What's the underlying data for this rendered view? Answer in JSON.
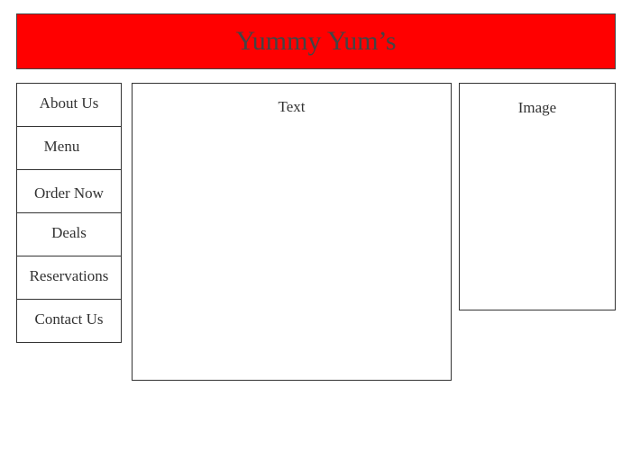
{
  "header": {
    "title": "Yummy Yum’s",
    "background_color": "#ff0000"
  },
  "nav": {
    "items": [
      {
        "label": "About Us"
      },
      {
        "label": "Menu"
      },
      {
        "label": "Order Now"
      },
      {
        "label": "Deals"
      },
      {
        "label": "Reservations"
      },
      {
        "label": "Contact Us"
      }
    ]
  },
  "main": {
    "text_label": "Text"
  },
  "aside": {
    "image_label": "Image"
  }
}
